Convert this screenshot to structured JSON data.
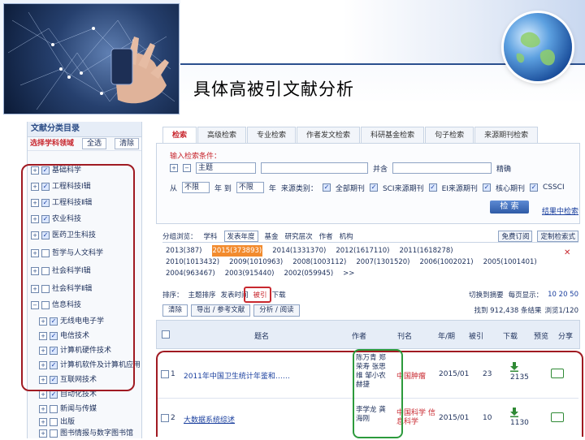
{
  "slide": {
    "title": "具体高被引文献分析"
  },
  "left_panel": {
    "heading": "文献分类目录",
    "subheading": "选择学科领域",
    "all_label": "全选",
    "clear_label": "清除",
    "categories": [
      {
        "label": "基础科学",
        "checked": true
      },
      {
        "label": "工程科技Ⅰ辑",
        "checked": true
      },
      {
        "label": "工程科技Ⅱ辑",
        "checked": true
      },
      {
        "label": "农业科技",
        "checked": true
      },
      {
        "label": "医药卫生科技",
        "checked": true
      },
      {
        "label": "哲学与人文科学",
        "checked": false
      },
      {
        "label": "社会科学Ⅰ辑",
        "checked": false
      },
      {
        "label": "社会科学Ⅱ辑",
        "checked": false
      },
      {
        "label": "信息科技",
        "checked": false
      }
    ],
    "subcategories": [
      {
        "label": "无线电电子学",
        "checked": true
      },
      {
        "label": "电信技术",
        "checked": true
      },
      {
        "label": "计算机硬件技术",
        "checked": true
      },
      {
        "label": "计算机软件及计算机应用",
        "checked": true
      },
      {
        "label": "互联网技术",
        "checked": true
      },
      {
        "label": "自动化技术",
        "checked": true
      },
      {
        "label": "新闻与传媒",
        "checked": false
      },
      {
        "label": "出版",
        "checked": false
      },
      {
        "label": "图书情报与数字图书馆",
        "checked": false
      }
    ]
  },
  "tabs": [
    "检索",
    "高级检索",
    "专业检索",
    "作者发文检索",
    "科研基金检索",
    "句子检索",
    "来源期刊检索"
  ],
  "search": {
    "condition_label": "输入检索条件：",
    "field_value": "主题",
    "match_value": "并含",
    "precision_value": "精确",
    "from_label": "从",
    "from_value": "不限",
    "year_label": "年 到",
    "to_value": "不限",
    "year_suffix": "年",
    "update_label": "来源类别：",
    "options": [
      "全部期刊",
      "SCI来源期刊",
      "EI来源期刊",
      "核心期刊",
      "CSSCI"
    ],
    "search_button": "检 索",
    "adv_link": "结果中检索"
  },
  "group_bar": {
    "label": "分组浏览：",
    "items": [
      "学科",
      "发表年度",
      "基金",
      "研究层次",
      "作者",
      "机构"
    ],
    "right_items": [
      "免费订阅",
      "定制检索式"
    ]
  },
  "years": [
    [
      "2013(387)",
      "2015(373893)",
      "2014(1331370)",
      "2012(1617110)",
      "2011(1618278)"
    ],
    [
      "2010(1013432)",
      "2009(1010963)",
      "2008(1003112)",
      "2007(1301520)",
      "2006(1002021)",
      "2005(1001401)"
    ],
    [
      "2004(963467)",
      "2003(915440)",
      "2002(059945)",
      ">>"
    ]
  ],
  "sort_bar": {
    "label": "排序：",
    "items": [
      "主题排序",
      "发表时间",
      "被引",
      "下载"
    ],
    "right_label": "切换到摘要",
    "per_page_label": "每页显示：",
    "per_page_options": "10 20 50"
  },
  "view_bar": {
    "tabs": [
      "清除",
      "导出 / 参考文献",
      "分析 / 阅读"
    ],
    "count_label": "找到 912,438 条结果",
    "page_label": "浏览1/120"
  },
  "table": {
    "headers": [
      "题名",
      "作者",
      "刊名",
      "年/期",
      "被引",
      "下载",
      "预览",
      "分享"
    ],
    "rows": [
      {
        "index": "1",
        "title": "2011年中国卫生统计年鉴和……",
        "authors": "陈万青 郑荣寿 张思维 邹小农 赫捷",
        "journal": "中国肿瘤",
        "year": "2015/01",
        "cited": "23",
        "downloads": "2135"
      },
      {
        "index": "2",
        "title": "大数据系统综述",
        "authors": "李学龙 龚海刚",
        "journal": "中国科学 信息科学",
        "year": "2015/01",
        "cited": "10",
        "downloads": "1130"
      }
    ]
  }
}
